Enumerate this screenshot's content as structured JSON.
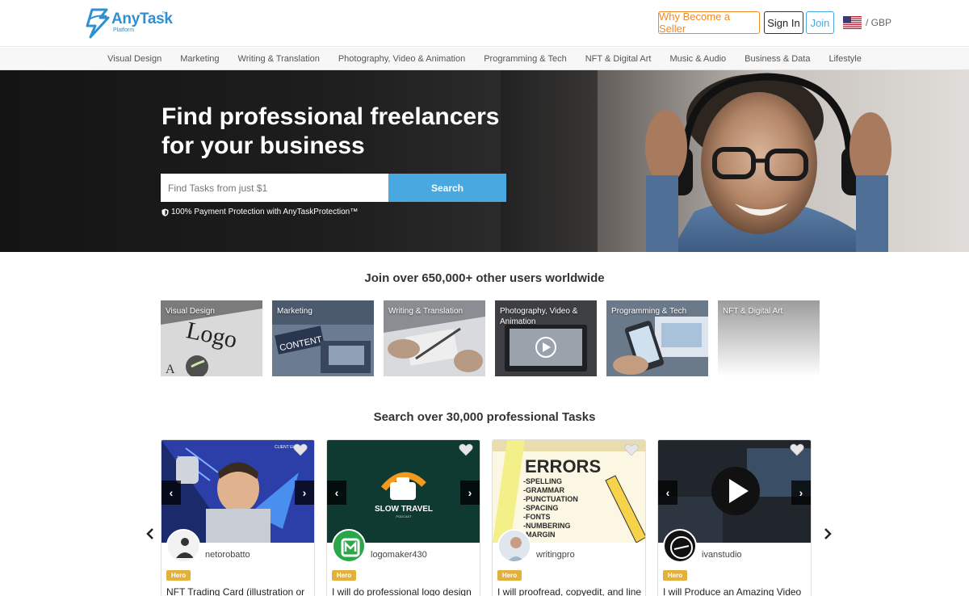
{
  "brand": {
    "name": "AnyTask",
    "tm": "™",
    "sub": "Platform"
  },
  "header": {
    "seller_label": "Why Become a Seller",
    "signin_label": "Sign In",
    "join_label": "Join",
    "currency": "/  GBP"
  },
  "nav": [
    "Visual Design",
    "Marketing",
    "Writing & Translation",
    "Photography, Video & Animation",
    "Programming & Tech",
    "NFT & Digital Art",
    "Music & Audio",
    "Business & Data",
    "Lifestyle"
  ],
  "hero": {
    "title_line1": "Find professional freelancers",
    "title_line2": "for your business",
    "search_placeholder": "Find Tasks from just $1",
    "search_button": "Search",
    "protection": "100% Payment Protection with AnyTaskProtection™"
  },
  "categories_section": {
    "title": "Join over 650,000+ other users worldwide",
    "tiles": [
      {
        "label": "Visual Design"
      },
      {
        "label": "Marketing"
      },
      {
        "label": "Writing & Translation"
      },
      {
        "label": "Photography, Video & Animation"
      },
      {
        "label": "Programming & Tech"
      },
      {
        "label": "NFT & Digital Art"
      }
    ]
  },
  "tasks_section": {
    "title": "Search over 30,000 professional Tasks",
    "cards": [
      {
        "user": "netorobatto",
        "badge": "Hero",
        "title": "NFT Trading Card (illustration or"
      },
      {
        "user": "logomaker430",
        "badge": "Hero",
        "title": "I will do professional logo design"
      },
      {
        "user": "writingpro",
        "badge": "Hero",
        "title": "I will proofread, copyedit, and line"
      },
      {
        "user": "ivanstudio",
        "badge": "Hero",
        "title": "I will Produce an Amazing Video"
      }
    ],
    "card2_image_text": {
      "line1": "SLOW TRAVEL",
      "line2": "PODCAST"
    },
    "card3_image_text": [
      "ERRORS",
      "-SPELLING",
      "-GRAMMAR",
      "-PUNCTUATION",
      "-SPACING",
      "-FONTS",
      "-NUMBERING",
      "-MARGIN"
    ],
    "tile_logo_text": "Logo",
    "tile_content_text": "CONTENT"
  },
  "colors": {
    "accent_blue": "#4aa8e0",
    "brand_blue": "#2e8fd1",
    "seller_orange": "#f08a24",
    "hero_badge": "#e2b13c"
  }
}
